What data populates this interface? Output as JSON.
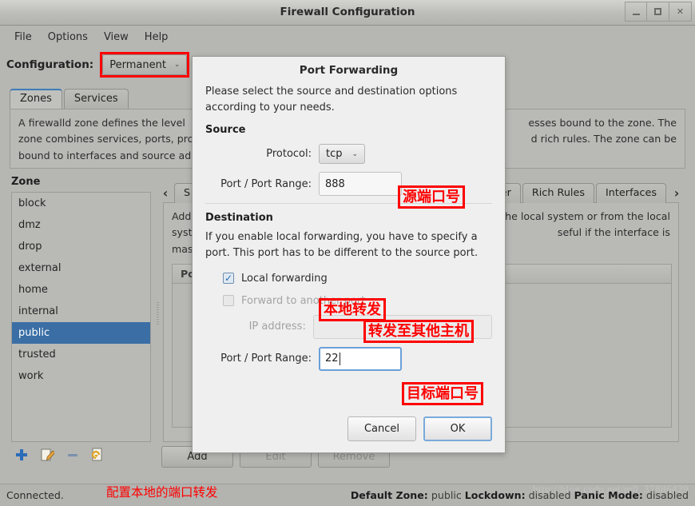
{
  "window": {
    "title": "Firewall Configuration",
    "controls": [
      {
        "name": "minimize",
        "glyph": "_"
      },
      {
        "name": "maximize",
        "glyph": "□"
      },
      {
        "name": "close",
        "glyph": "✕"
      }
    ]
  },
  "menubar": {
    "items": [
      "File",
      "Options",
      "View",
      "Help"
    ]
  },
  "config": {
    "label": "Configuration:",
    "value": "Permanent",
    "chevron": "⌄"
  },
  "main_tabs": [
    {
      "label": "Zones",
      "active": true
    },
    {
      "label": "Services",
      "active": false
    }
  ],
  "zone_description": {
    "line1_left": "A firewalld zone defines the level",
    "line1_right": "esses bound to the zone. The",
    "line2_left": "zone combines services, ports, pro",
    "line2_right": "d rich rules. The zone can be",
    "line3_left": "bound to interfaces and source add"
  },
  "zone_panel": {
    "heading": "Zone",
    "items": [
      {
        "label": "block",
        "selected": false
      },
      {
        "label": "dmz",
        "selected": false
      },
      {
        "label": "drop",
        "selected": false
      },
      {
        "label": "external",
        "selected": false
      },
      {
        "label": "home",
        "selected": false
      },
      {
        "label": "internal",
        "selected": false
      },
      {
        "label": "public",
        "selected": true
      },
      {
        "label": "trusted",
        "selected": false
      },
      {
        "label": "work",
        "selected": false
      }
    ],
    "tools": [
      "add-zone-icon",
      "edit-zone-icon",
      "remove-zone-icon",
      "load-defaults-icon"
    ]
  },
  "sub_tabs": {
    "prev_arrow": "‹",
    "next_arrow": "›",
    "items": [
      {
        "label": "S",
        "truncated": true
      },
      {
        "label": "ter",
        "truncated": true
      },
      {
        "label": "Rich Rules",
        "truncated": false
      },
      {
        "label": "Interfaces",
        "truncated": false
      }
    ]
  },
  "forward_panel": {
    "desc_left": [
      "Add e",
      "system",
      "masqu"
    ],
    "desc_right": [
      "he local system or from the local",
      "seful if the interface is"
    ],
    "table_columns": [
      "Port"
    ]
  },
  "action_buttons": [
    {
      "label": "Add",
      "disabled": false
    },
    {
      "label": "Edit",
      "disabled": true
    },
    {
      "label": "Remove",
      "disabled": true
    }
  ],
  "statusbar": {
    "connection": "Connected.",
    "default_zone_label": "Default Zone:",
    "default_zone_value": "public",
    "lockdown_label": "Lockdown:",
    "lockdown_value": "disabled",
    "panic_label": "Panic Mode:",
    "panic_value": "disabled",
    "watermark": "http://blog.csdn.net/m0_37886429"
  },
  "dialog": {
    "title": "Port Forwarding",
    "intro_line1": "Please select the source and destination options",
    "intro_line2": "according to your needs.",
    "source_heading": "Source",
    "protocol_label": "Protocol:",
    "protocol_value": "tcp",
    "protocol_chevron": "⌄",
    "source_port_label": "Port / Port Range:",
    "source_port_value": "888",
    "destination_heading": "Destination",
    "dest_note_line1": "If you enable local forwarding, you have to specify a",
    "dest_note_line2": "port. This port has to be different to the source port.",
    "local_forwarding_label": "Local forwarding",
    "local_forwarding_checked": true,
    "forward_another_label": "Forward to another port",
    "forward_another_checked": false,
    "forward_another_disabled": true,
    "ip_address_label": "IP address:",
    "ip_address_value": "",
    "ip_address_disabled": true,
    "dest_port_label": "Port / Port Range:",
    "dest_port_value": "22",
    "cancel_label": "Cancel",
    "ok_label": "OK"
  },
  "annotations": {
    "source_port": "源端口号",
    "local_forwarding": "本地转发",
    "forward_other_host": "转发至其他主机",
    "dest_port": "目标端口号",
    "status_note": "配置本地的端口转发"
  },
  "colors": {
    "annotation_red": "#fe0000",
    "selection_blue": "#3a6ea5",
    "focus_blue": "#6aa0d8",
    "window_bg": "#b6b6b3",
    "dialog_bg": "#efefef"
  }
}
